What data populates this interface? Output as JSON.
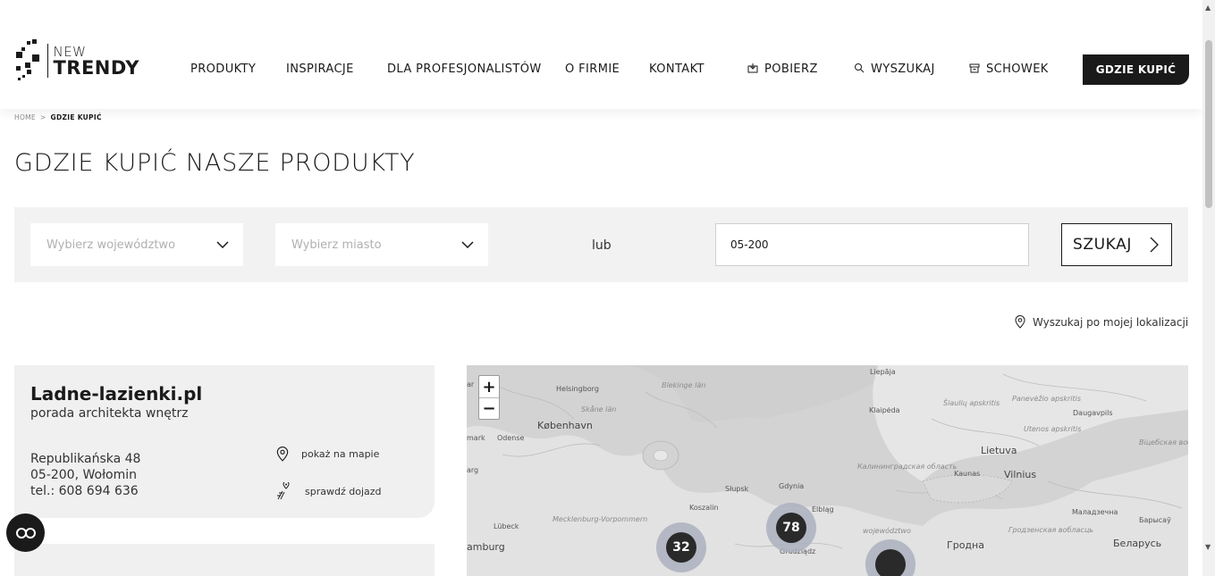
{
  "brand": {
    "line1": "NEW",
    "line2": "TRENDY"
  },
  "nav": {
    "items": [
      {
        "label": "PRODUKTY"
      },
      {
        "label": "INSPIRACJE"
      },
      {
        "label": "DLA PROFESJONALISTÓW"
      },
      {
        "label": "O FIRMIE"
      },
      {
        "label": "KONTAKT"
      }
    ],
    "utility": [
      {
        "label": "POBIERZ",
        "icon": "download-icon"
      },
      {
        "label": "WYSZUKAJ",
        "icon": "search-icon"
      },
      {
        "label": "SCHOWEK",
        "icon": "box-icon"
      }
    ],
    "cta": "GDZIE KUPIĆ"
  },
  "breadcrumb": {
    "home": "HOME",
    "separator": ">",
    "current": "GDZIE KUPIĆ"
  },
  "page": {
    "title": "GDZIE KUPIĆ NASZE PRODUKTY"
  },
  "filters": {
    "voivodeship_placeholder": "Wybierz województwo",
    "city_placeholder": "Wybierz miasto",
    "or_label": "lub",
    "zip_value": "05-200",
    "search_label": "SZUKAJ"
  },
  "geolocate": {
    "label": "Wyszukaj po mojej lokalizacji"
  },
  "dealers": [
    {
      "name": "Ladne-lazienki.pl",
      "subtitle": "porada architekta wnętrz",
      "street": "Republikańska 48",
      "city": "05-200, Wołomin",
      "phone": "tel.: 608 694 636",
      "show_on_map": "pokaż na mapie",
      "check_route": "sprawdź dojazd"
    }
  ],
  "map": {
    "zoom_in": "+",
    "zoom_out": "−",
    "clusters": [
      {
        "count": "32"
      },
      {
        "count": "78"
      },
      {
        "count": ""
      }
    ],
    "labels": {
      "helsingborg": "Helsingborg",
      "blekinge": "Blekinge län",
      "skane": "Skåne län",
      "kobenhavn": "København",
      "odense": "Odense",
      "liepaja": "Liepāja",
      "klaipeda": "Klaipėda",
      "siauliu": "Šiaulių apskritis",
      "panevezio": "Panevėžio apskritis",
      "daugavpils": "Daugavpils",
      "utenos": "Utenos apskritis",
      "lietuva": "Lietuva",
      "kaunas": "Kaunas",
      "vilnius": "Vilnius",
      "vitebsk": "Віцебская вобласць",
      "kaliningrad": "Калининградская область",
      "slupsk": "Słupsk",
      "gdynia": "Gdynia",
      "elblag": "Elbląg",
      "koszalin": "Koszalin",
      "lubeck": "Lübeck",
      "mecklenburg": "Mecklenburg-Vorpommern",
      "hamburg": "amburg",
      "grudziadz": "Grudziądz",
      "wojewodztwo": "województwo",
      "hrodna": "Гродна",
      "hrodna_obl": "Гродзенская вобласць",
      "maladzechna": "Маладзечна",
      "barysau": "Барысаў",
      "belarus": "Беларусь",
      "mark": "mark",
      "arg": "arg",
      "ar": "ar"
    }
  },
  "colors": {
    "accent": "#1a1a1a",
    "panel": "#f0f0f0",
    "cluster": "#aab0be"
  }
}
